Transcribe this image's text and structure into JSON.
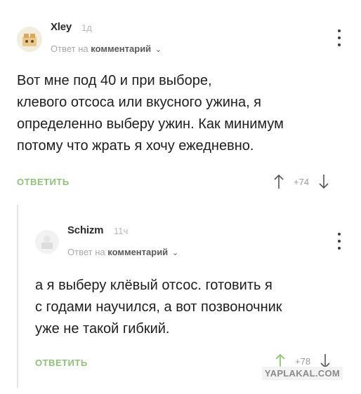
{
  "comments": [
    {
      "author": "Xley",
      "age": "1д",
      "reply_prefix": "Ответ на",
      "reply_target": "комментарий",
      "reply_chevron": "⌄",
      "avatar_icon": "cartoon-avatar",
      "text": "Вот мне под 40 и при выборе,\nклевого отсоса или вкусного ужина, я\nопределенно выберу ужин. Как минимум\nпотому что жрать я хочу ежедневно.",
      "reply_button": "ОТВЕТИТЬ",
      "score": "+74"
    },
    {
      "author": "Schizm",
      "age": "11ч",
      "reply_prefix": "Ответ на",
      "reply_target": "комментарий",
      "reply_chevron": "⌄",
      "avatar_icon": "default-avatar",
      "text": "а я выберу клёвый отсос.  готовить я\nс годами научился, а вот позвоночник\nуже не такой гибкий.",
      "reply_button": "ОТВЕТИТЬ",
      "score": "+78"
    }
  ],
  "watermark": "YAPLAKAL.COM",
  "colors": {
    "accent_green": "#8fc27a",
    "muted_text": "#a9a9a9",
    "thread_line": "#e6e6e6"
  }
}
